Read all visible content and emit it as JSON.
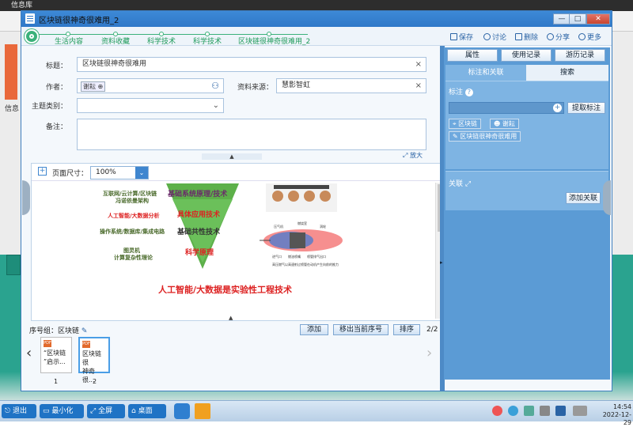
{
  "background": {
    "top_title": "信息库",
    "side_label": "信息"
  },
  "window": {
    "title": "区块链很神奇很难用_2",
    "minimize": "—",
    "maximize": "□",
    "close": "✕"
  },
  "breadcrumbs": [
    "生活内容",
    "资料收藏",
    "科学技术",
    "科学技术",
    "区块链很神奇很难用_2"
  ],
  "toolbar": {
    "save": "保存",
    "discuss": "讨论",
    "delete": "删除",
    "share": "分享",
    "more": "更多"
  },
  "form": {
    "title_label": "标题：",
    "title_value": "区块链很神奇很难用",
    "author_label": "作者：",
    "author_tag": "谢耘",
    "source_label": "资料来源：",
    "source_value": "慧影智虹",
    "topic_label": "主题类别：",
    "topic_value": "",
    "note_label": "备注：",
    "note_value": ""
  },
  "preview": {
    "page_size_label": "页面尺寸：",
    "zoom": "100%",
    "enlarge": "放大",
    "slide_left": [
      "互联网/云计算/区块链",
      "冯诺依曼架构",
      "人工智能/大数据分析",
      "操作系统/数据库/集成电路",
      "图灵机",
      "计算复杂性理论"
    ],
    "pyramid": [
      "基础系统原理/技术",
      "具体应用技术",
      "基础共性技术",
      "科学原理"
    ],
    "engine_caption": "高压燃气以高速射过喷管在动机产生向前的推力",
    "engine_labels": [
      "压气机",
      "燃烧室",
      "涡轮",
      "进气口",
      "燃油喷嘴",
      "喷管排气出口"
    ],
    "slide_footer": "人工智能/大数据是实验性工程技术"
  },
  "sequence": {
    "label": "序号组：区块链",
    "add": "添加",
    "move_out": "移出当前序号",
    "sort": "排序",
    "page": "2/2",
    "items": [
      {
        "line1": "“区块链",
        "line2": "”启示...",
        "num": "1"
      },
      {
        "line1": "区块链很",
        "line2": "神奇很...",
        "num": "2"
      }
    ]
  },
  "right": {
    "buttons": [
      "属性",
      "使用记录",
      "游历记录"
    ],
    "tabs": [
      "标注和关联",
      "搜索"
    ],
    "annotate_label": "标注",
    "extract_button": "提取标注",
    "chips": [
      "区块链",
      "谢耘",
      "区块链很神奇很难用"
    ],
    "link_label": "关联",
    "add_link_button": "添加关联"
  },
  "taskbar": {
    "exit": "退出",
    "minimize": "最小化",
    "fullscreen": "全屏",
    "desktop": "桌面",
    "time": "14:54",
    "date": "2022-12-29"
  }
}
